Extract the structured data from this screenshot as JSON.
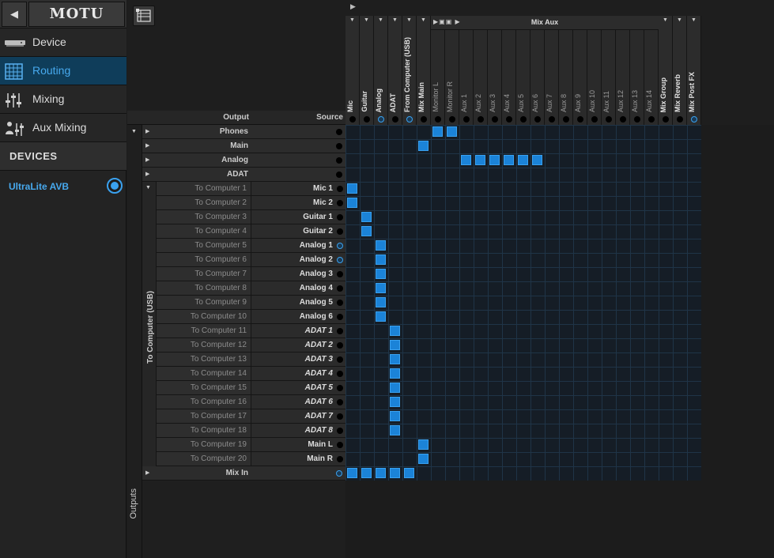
{
  "app": {
    "brand": "MOTU"
  },
  "sidebar": {
    "nav": [
      {
        "label": "Device",
        "icon": "device-icon"
      },
      {
        "label": "Routing",
        "icon": "routing-grid-icon",
        "active": true
      },
      {
        "label": "Mixing",
        "icon": "mixer-faders-icon"
      },
      {
        "label": "Aux Mixing",
        "icon": "aux-mixing-icon"
      }
    ],
    "devices_header": "DEVICES",
    "device": {
      "label": "UltraLite AVB",
      "selected": true
    }
  },
  "routing": {
    "output_header": "Output",
    "source_header": "Source",
    "outputs_label": "Outputs",
    "usb_group_label": "To Computer (USB)",
    "mix_aux_label": "Mix Aux",
    "groups": [
      {
        "label": "Phones"
      },
      {
        "label": "Main"
      },
      {
        "label": "Analog"
      },
      {
        "label": "ADAT"
      }
    ],
    "mix_in_label": "Mix In",
    "columns": [
      {
        "label": "Mic"
      },
      {
        "label": "Guitar"
      },
      {
        "label": "Analog"
      },
      {
        "label": "ADAT"
      },
      {
        "label": "From Computer (USB)"
      },
      {
        "label": "Mix Main"
      },
      {
        "label": "Monitor L"
      },
      {
        "label": "Monitor R"
      },
      {
        "label": "Aux 1"
      },
      {
        "label": "Aux 2"
      },
      {
        "label": "Aux 3"
      },
      {
        "label": "Aux 4"
      },
      {
        "label": "Aux 5"
      },
      {
        "label": "Aux 6"
      },
      {
        "label": "Aux 7"
      },
      {
        "label": "Aux 8"
      },
      {
        "label": "Aux 9"
      },
      {
        "label": "Aux 10"
      },
      {
        "label": "Aux 11"
      },
      {
        "label": "Aux 12"
      },
      {
        "label": "Aux 13"
      },
      {
        "label": "Aux 14"
      },
      {
        "label": "Mix Group"
      },
      {
        "label": "Mix Reverb"
      },
      {
        "label": "Mix Post FX"
      }
    ],
    "channels": [
      {
        "output": "To Computer 1",
        "source": "Mic 1"
      },
      {
        "output": "To Computer 2",
        "source": "Mic 2"
      },
      {
        "output": "To Computer 3",
        "source": "Guitar 1"
      },
      {
        "output": "To Computer 4",
        "source": "Guitar 2"
      },
      {
        "output": "To Computer 5",
        "source": "Analog 1"
      },
      {
        "output": "To Computer 6",
        "source": "Analog 2"
      },
      {
        "output": "To Computer 7",
        "source": "Analog 3"
      },
      {
        "output": "To Computer 8",
        "source": "Analog 4"
      },
      {
        "output": "To Computer 9",
        "source": "Analog 5"
      },
      {
        "output": "To Computer 10",
        "source": "Analog 6"
      },
      {
        "output": "To Computer 11",
        "source": "ADAT 1"
      },
      {
        "output": "To Computer 12",
        "source": "ADAT 2"
      },
      {
        "output": "To Computer 13",
        "source": "ADAT 3"
      },
      {
        "output": "To Computer 14",
        "source": "ADAT 4"
      },
      {
        "output": "To Computer 15",
        "source": "ADAT 5"
      },
      {
        "output": "To Computer 16",
        "source": "ADAT 6"
      },
      {
        "output": "To Computer 17",
        "source": "ADAT 7"
      },
      {
        "output": "To Computer 18",
        "source": "ADAT 8"
      },
      {
        "output": "To Computer 19",
        "source": "Main L"
      },
      {
        "output": "To Computer 20",
        "source": "Main R"
      }
    ],
    "connections": [
      [
        0,
        6
      ],
      [
        0,
        7
      ],
      [
        1,
        5
      ],
      [
        2,
        8
      ],
      [
        2,
        9
      ],
      [
        2,
        10
      ],
      [
        2,
        11
      ],
      [
        2,
        12
      ],
      [
        2,
        13
      ],
      [
        4,
        0
      ],
      [
        5,
        0
      ],
      [
        6,
        1
      ],
      [
        7,
        1
      ],
      [
        8,
        2
      ],
      [
        9,
        2
      ],
      [
        10,
        2
      ],
      [
        11,
        2
      ],
      [
        12,
        2
      ],
      [
        13,
        2
      ],
      [
        14,
        3
      ],
      [
        15,
        3
      ],
      [
        16,
        3
      ],
      [
        17,
        3
      ],
      [
        18,
        3
      ],
      [
        19,
        3
      ],
      [
        20,
        3
      ],
      [
        21,
        3
      ],
      [
        22,
        5
      ],
      [
        23,
        5
      ],
      [
        24,
        0
      ],
      [
        24,
        1
      ],
      [
        24,
        2
      ],
      [
        24,
        3
      ],
      [
        24,
        4
      ]
    ]
  },
  "colors": {
    "accent": "#3aa1ef",
    "route_cell": "#1b83d8",
    "grid_line": "#1f3447"
  }
}
